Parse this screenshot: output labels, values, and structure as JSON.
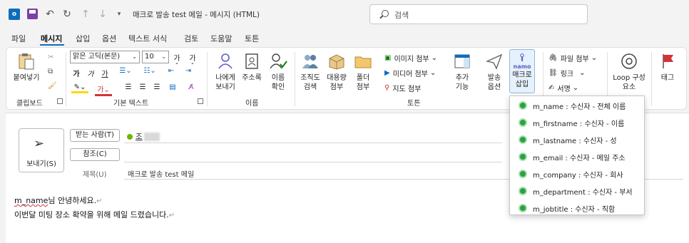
{
  "titlebar": {
    "title": "매크로 발송 test 메일  -  메시지 (HTML)",
    "search_placeholder": "검색",
    "app_icon": "outlook-icon",
    "qat": [
      "save-icon",
      "undo-icon",
      "redo-icon",
      "up-arrow-icon",
      "down-arrow-icon",
      "customize-qat-icon"
    ]
  },
  "menu": {
    "tabs": [
      "파일",
      "메시지",
      "삽입",
      "옵션",
      "텍스트 서식",
      "검토",
      "도움말",
      "토튼"
    ],
    "active": "메시지"
  },
  "ribbon": {
    "clipboard": {
      "paste": "붙여넣기",
      "group": "클립보드"
    },
    "basic_text": {
      "font": "맑은 고딕(본문)",
      "size": "10",
      "grow": "가ˆ",
      "shrink": "가ˇ",
      "bold": "가",
      "italic": "가",
      "underline": "가",
      "fontcolor": "가",
      "group": "기본 텍스트"
    },
    "names": {
      "to_me": "나에게\n보내기",
      "address_book": "주소록",
      "check_names": "이름\n확인",
      "group": "이름"
    },
    "tools": {
      "lookup": "조직도\n검색",
      "bulk": "대용량\n첨부",
      "folder": "폴더\n첨부",
      "image_attach": "이미지 첨부",
      "media_attach": "미디어 첨부",
      "map_attach": "지도 첨부",
      "addin": "추가\n기능",
      "send_opt": "발송\n옵션",
      "macro_top": "namo",
      "macro": "매크로\n삽입",
      "group": "토튼"
    },
    "include": {
      "file_attach": "파일 첨부",
      "link": "링크",
      "signature": "서명"
    },
    "loop": {
      "label": "Loop 구성\n요소"
    },
    "tags": {
      "label": "태그"
    }
  },
  "compose": {
    "send": "보내기(S)",
    "to_button": "받는 사람(T)",
    "cc_button": "참조(C)",
    "recipient_visible": "조",
    "subject_label": "제목(U)",
    "subject": "매크로 발송 test 메일",
    "body_line1_token": "m_name",
    "body_line1_rest": "님 안녕하세요.",
    "body_line2": "이번달 미팅 장소 확약을 위해 메일 드렸습니다."
  },
  "macro_menu": [
    "m_name : 수신자 - 전체 이름",
    "m_firstname : 수신자 - 이름",
    "m_lastname : 수신자 - 성",
    "m_email : 수신자 - 메일 주소",
    "m_company : 수신자 - 회사",
    "m_department : 수신자 - 부서",
    "m_jobtitle : 수신자 - 직함"
  ]
}
